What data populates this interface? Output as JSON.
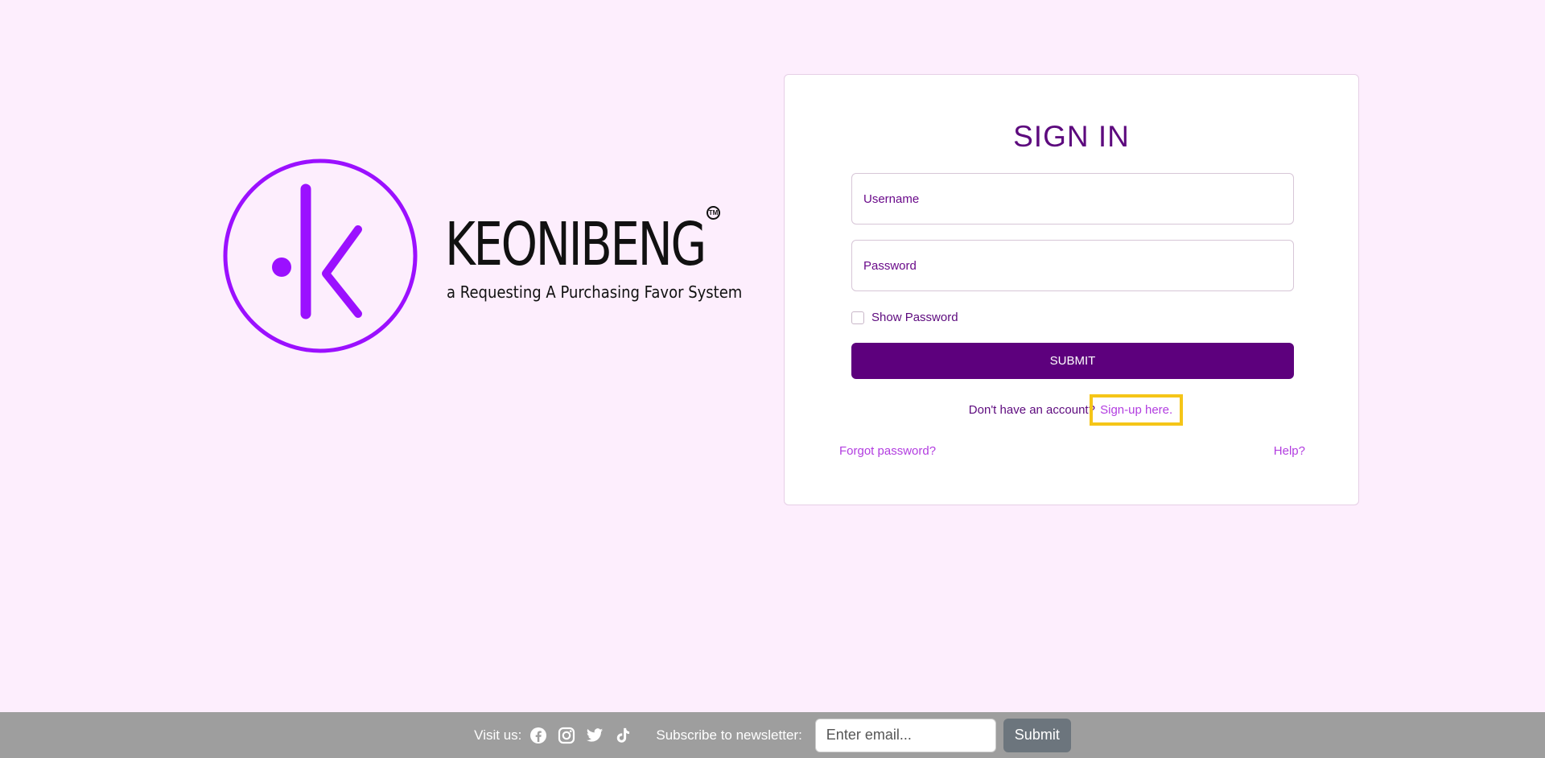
{
  "brand": {
    "name": "KEONIBENG",
    "tagline": "a Requesting A Purchasing Favor System",
    "trademark": "TM",
    "accent_color": "#9b10ff"
  },
  "signin": {
    "title": "SIGN IN",
    "username_placeholder": "Username",
    "password_placeholder": "Password",
    "show_password_label": "Show Password",
    "submit_label": "SUBMIT",
    "no_account_text": "Don't have an account?",
    "signup_link": "Sign-up here.",
    "forgot_password": "Forgot password?",
    "help": "Help?"
  },
  "footer": {
    "visit_label": "Visit us:",
    "social_icons": [
      "facebook-icon",
      "instagram-icon",
      "twitter-icon",
      "tiktok-icon"
    ],
    "subscribe_label": "Subscribe to newsletter:",
    "email_placeholder": "Enter email...",
    "submit_label": "Submit"
  },
  "colors": {
    "background": "#fdeefd",
    "primary": "#5d007d",
    "link": "#b23de0",
    "highlight": "#f5c518",
    "footer": "#9e9e9e"
  }
}
